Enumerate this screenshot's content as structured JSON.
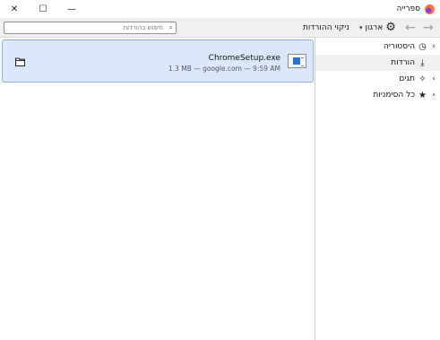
{
  "window": {
    "title": "ספרייה",
    "minimize_glyph": "—",
    "maximize_glyph": "☐",
    "close_glyph": "✕"
  },
  "toolbar": {
    "back_glyph": "→",
    "forward_glyph": "←",
    "organize_label": "ארגון",
    "organize_arrow": "▾",
    "clear_downloads_label": "ניקוי ההורדות",
    "search_placeholder": "חיפוש בהורדות"
  },
  "sidebar": {
    "items": [
      {
        "label": "היסטוריה",
        "icon": "clock-icon",
        "icon_glyph": "◷",
        "expandable": true,
        "chevron": "‹",
        "selected": false
      },
      {
        "label": "הורדות",
        "icon": "download-icon",
        "icon_glyph": "⤓",
        "expandable": false,
        "chevron": "",
        "selected": true
      },
      {
        "label": "תגים",
        "icon": "tags-icon",
        "icon_glyph": "✧",
        "expandable": true,
        "chevron": "‹",
        "selected": false
      },
      {
        "label": "כל הסימניות",
        "icon": "star-icon",
        "icon_glyph": "★",
        "expandable": true,
        "chevron": "‹",
        "selected": false
      }
    ]
  },
  "downloads": [
    {
      "file_name": "ChromeSetup.exe",
      "meta": "1.3 MB — google.com — 9:59 AM",
      "icon": "exe-file-icon",
      "action_icon": "folder-icon"
    }
  ],
  "colors": {
    "selection_bg": "#dbe8fb",
    "selection_border": "#8db2e8",
    "toolbar_bg": "#f0f0f0"
  }
}
